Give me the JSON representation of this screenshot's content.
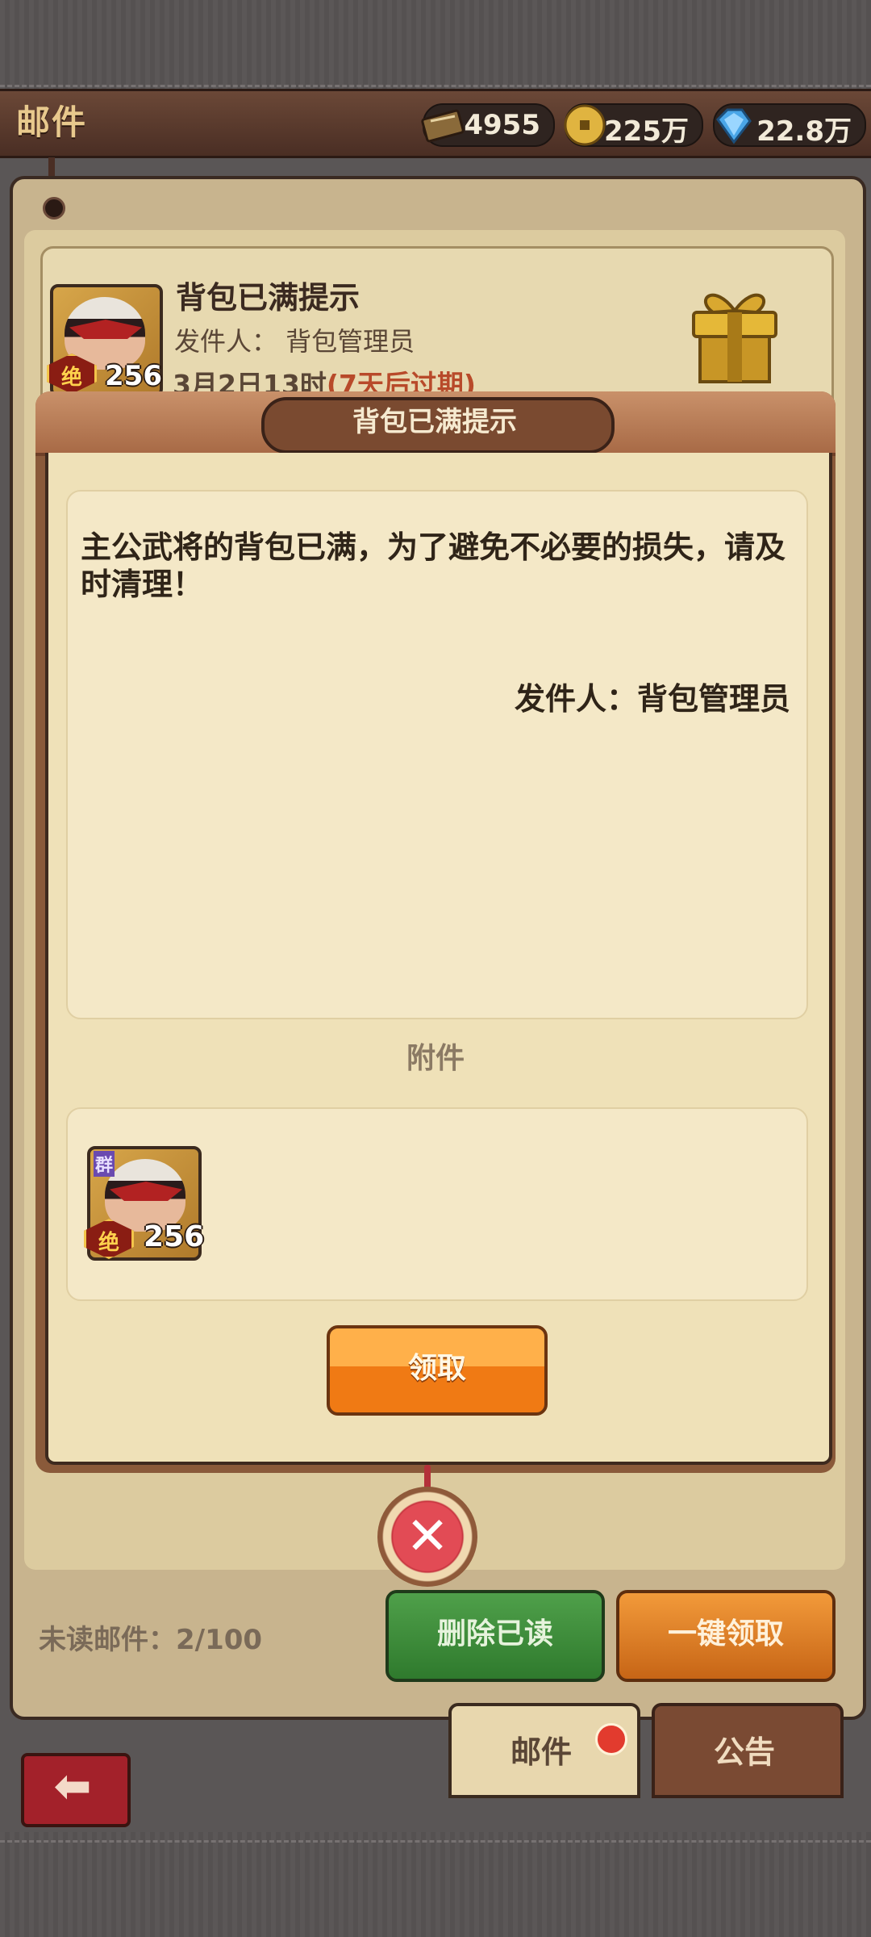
{
  "header": {
    "title": "邮件",
    "resources": [
      {
        "icon": "ticket-icon",
        "value": "4955"
      },
      {
        "icon": "coin-icon",
        "value": "225万"
      },
      {
        "icon": "diamond-icon",
        "value": "22.8万"
      }
    ]
  },
  "mail_card": {
    "title": "背包已满提示",
    "sender": "发件人： 背包管理员",
    "date": "3月2日13时",
    "expire": "(7天后过期)",
    "avatar_level": "256",
    "avatar_badge": "绝"
  },
  "popup": {
    "title": "背包已满提示",
    "message": "主公武将的背包已满，为了避免不必要的损失，请及时清理！",
    "sender": "发件人：背包管理员",
    "attachment_label": "附件",
    "attachment": {
      "level": "256",
      "badge": "绝",
      "tag": "群"
    },
    "claim_button": "领取"
  },
  "bottom": {
    "unread": "未读邮件：2/100",
    "delete_read": "删除已读",
    "claim_all": "一键领取"
  },
  "tabs": [
    {
      "label": "邮件",
      "active": true
    },
    {
      "label": "公告",
      "active": false
    }
  ]
}
